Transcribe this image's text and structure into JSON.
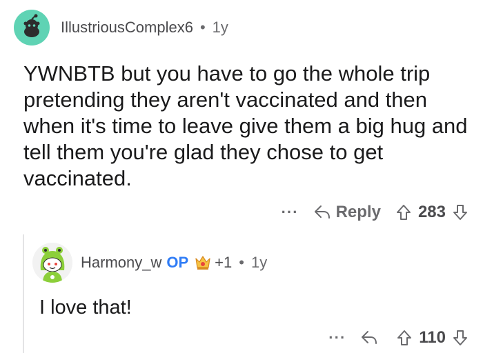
{
  "comment": {
    "username": "IllustriousComplex6",
    "separator": "•",
    "age": "1y",
    "body": "YWNBTB but you have to go the whole trip pretending they aren't vaccinated and then when it's time to leave give them a big hug and tell them you're glad they chose to get vaccinated.",
    "more_label": "···",
    "reply_label": "Reply",
    "score": "283",
    "avatar_color": "#5fd3b4"
  },
  "reply": {
    "username": "Harmony_w",
    "op_badge": "OP",
    "award_count": "+1",
    "separator": "•",
    "age": "1y",
    "body": "I love that!",
    "more_label": "···",
    "score": "110",
    "op_color": "#2f7cf6"
  },
  "icons": {
    "reply": "reply-arrow-icon",
    "upvote": "upvote-arrow-icon",
    "downvote": "downvote-arrow-icon",
    "award": "award-icon"
  }
}
